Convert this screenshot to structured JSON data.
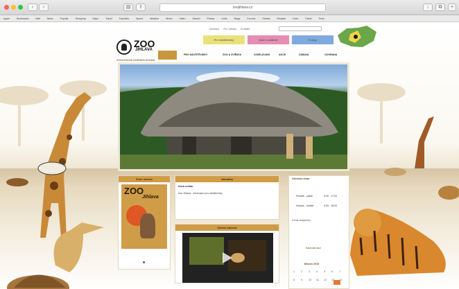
{
  "browser": {
    "url": "zoojihlava.cz",
    "bookmarks": [
      "Apple",
      "Bookmarks",
      "Mail",
      "News",
      "Popular",
      "Shopping",
      "Maps",
      "Travel",
      "Favorites",
      "Sports",
      "Weather",
      "Music",
      "Video",
      "Search",
      "Photos",
      "Links",
      "Blogs",
      "Forums",
      "Games",
      "Recipes",
      "Docs",
      "Cloud",
      "Tools"
    ]
  },
  "header": {
    "logo_text": "ZOO",
    "logo_city": "JIHLAVA",
    "logo_subtitle": "ZOOLOGICKÁ ZAHRADA JIHLAVA",
    "toplinks": [
      "Novinky",
      "Pro média",
      "Kontakt"
    ],
    "buttons": [
      {
        "label": "Pro návštěvníky",
        "color": "#e9e27a"
      },
      {
        "label": "Akce a události",
        "color": "#e58db3"
      },
      {
        "label": "E-shop",
        "color": "#7faadf"
      }
    ]
  },
  "menu": [
    "ÚVOD",
    "PRO NÁVŠTĚVNÍKY",
    "ZOO A ZVÍŘATA",
    "VZDĚLÁVÁNÍ",
    "AKCE",
    "ZÁBAVA",
    "OCHRANA"
  ],
  "boxes": {
    "left": {
      "title": "Zvíře měsíce",
      "poster_text": "ZOO",
      "poster_sub": "Jihlava"
    },
    "news": {
      "title": "Aktuality",
      "headline": "Nová zvířata",
      "body": "Zoo Jihlava - informace pro návštěvníky"
    },
    "video": {
      "title": "Zvířecí kamera"
    },
    "right": {
      "title": "Otevírací doba",
      "rows": [
        [
          "Pondělí - pátek",
          "9:00 - 17:00"
        ],
        [
          "Sobota - neděle",
          "9:00 - 18:00"
        ]
      ],
      "footer": "Ceník vstupného",
      "section2": "Kalendář akcí",
      "month": "Březen 2015"
    }
  },
  "calendar": [
    "1",
    "2",
    "3",
    "4",
    "5",
    "6",
    "7",
    "8",
    "9",
    "10",
    "11",
    "12",
    "13",
    "14"
  ]
}
